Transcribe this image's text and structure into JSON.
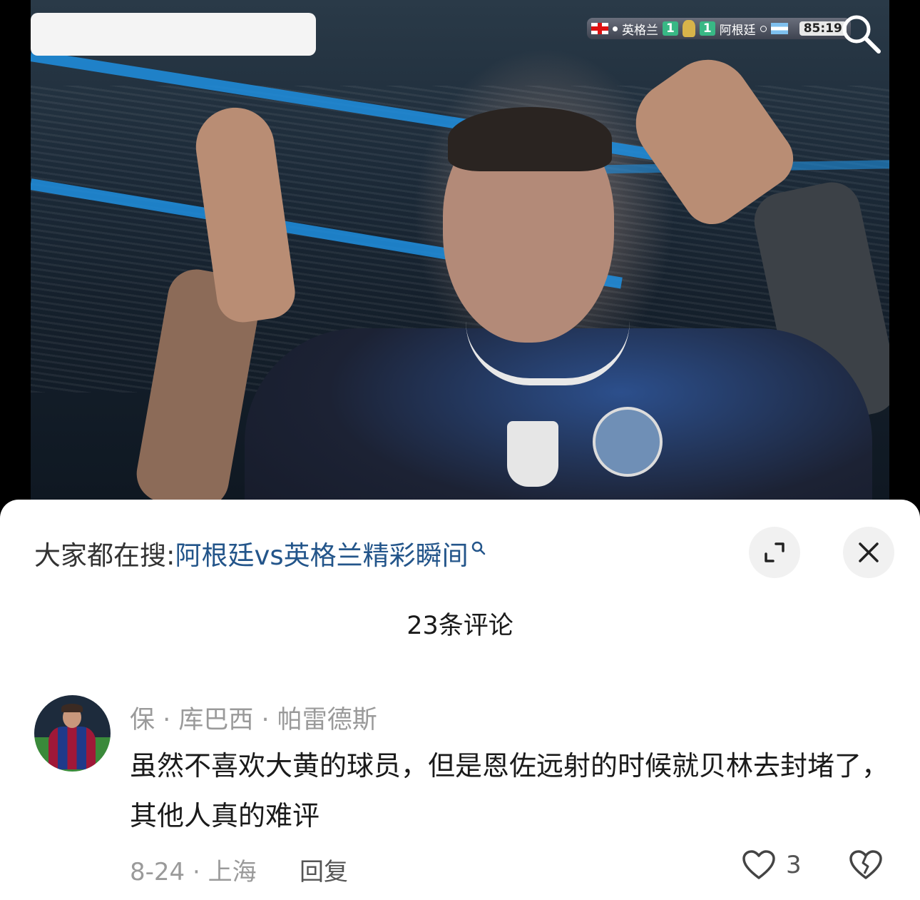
{
  "video": {
    "scoreboard": {
      "home_team": "英格兰",
      "home_score": "1",
      "away_score": "1",
      "away_team": "阿根廷",
      "clock": "85:19"
    }
  },
  "search_bar": {
    "prefix": "大家都在搜:",
    "keyword": "阿根廷vs英格兰精彩瞬间"
  },
  "comments_header": {
    "count_label": "23条评论"
  },
  "comment": {
    "username": "保 · 库巴西 · 帕雷德斯",
    "text": "虽然不喜欢大黄的球员，但是恩佐远射的时候就贝林去封堵了，其他人真的难评",
    "meta": "8-24 · 上海",
    "reply_label": "回复",
    "like_count": "3"
  },
  "colors": {
    "keyword": "#23558a",
    "score_green": "#38b885",
    "muted": "#9a9a9a"
  },
  "icons": {
    "zoom": "search-icon",
    "expand": "expand-icon",
    "close": "close-icon",
    "like": "heart-icon",
    "dislike": "broken-heart-icon"
  }
}
